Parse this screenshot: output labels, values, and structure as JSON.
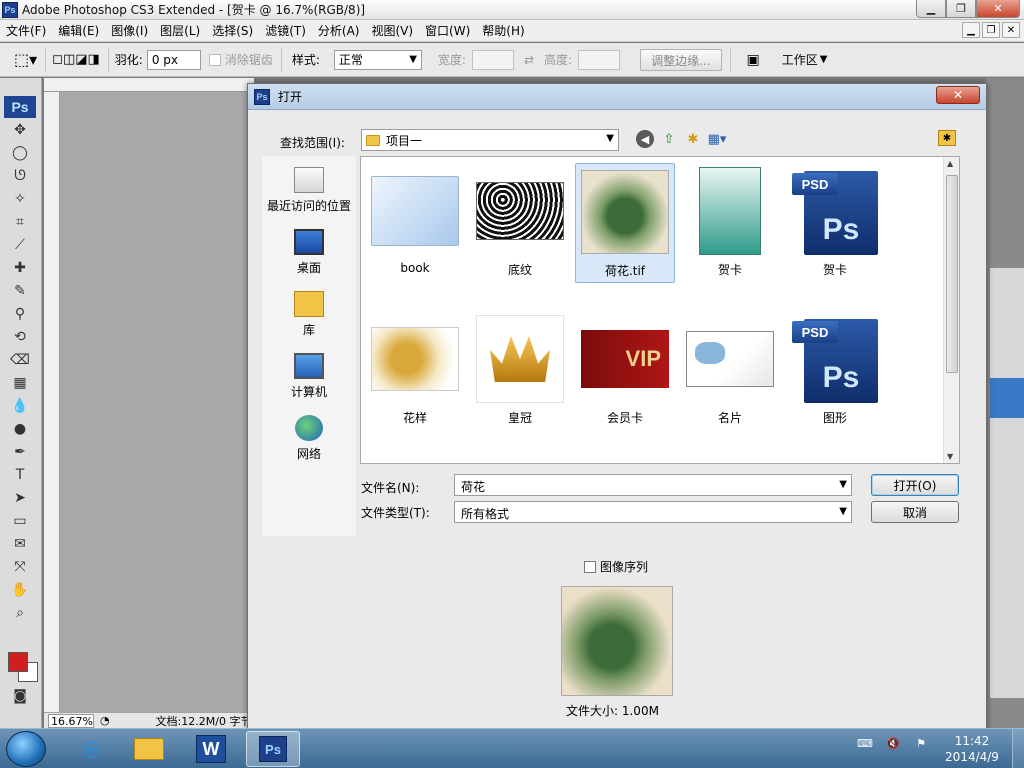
{
  "app": {
    "title": "Adobe Photoshop CS3 Extended - [贺卡 @ 16.7%(RGB/8)]",
    "icon_label": "Ps"
  },
  "menu": [
    "文件(F)",
    "编辑(E)",
    "图像(I)",
    "图层(L)",
    "选择(S)",
    "滤镜(T)",
    "分析(A)",
    "视图(V)",
    "窗口(W)",
    "帮助(H)"
  ],
  "options_bar": {
    "feather_label": "羽化:",
    "feather_value": "0 px",
    "antialias_label": "消除锯齿",
    "style_label": "样式:",
    "style_value": "正常",
    "width_label": "宽度:",
    "height_label": "高度:",
    "refine_button": "调整边缘...",
    "workspace_label": "工作区"
  },
  "toolbox": {
    "ps_label": "Ps",
    "fg_color": "#d01f1f",
    "bg_color": "#ffffff"
  },
  "status": {
    "zoom": "16.67%",
    "doc_info": "文档:12.2M/0 字节"
  },
  "dialog": {
    "title": "打开",
    "look_in_label": "查找范围(I):",
    "look_in_value": "项目一",
    "places": [
      {
        "label": "最近访问的位置",
        "icon": "recent-places-icon"
      },
      {
        "label": "桌面",
        "icon": "desktop-icon"
      },
      {
        "label": "库",
        "icon": "library-icon"
      },
      {
        "label": "计算机",
        "icon": "computer-icon"
      },
      {
        "label": "网络",
        "icon": "network-icon"
      }
    ],
    "files": [
      {
        "label": "book"
      },
      {
        "label": "底纹"
      },
      {
        "label": "荷花.tif",
        "selected": true
      },
      {
        "label": "贺卡"
      },
      {
        "label": "贺卡"
      },
      {
        "label": "花样"
      },
      {
        "label": "皇冠"
      },
      {
        "label": "会员卡"
      },
      {
        "label": "名片"
      },
      {
        "label": "图形"
      }
    ],
    "psd_tag": "PSD",
    "psd_letters": "Ps",
    "vip_text": "VIP",
    "filename_label": "文件名(N):",
    "filename_value": "荷花",
    "filetype_label": "文件类型(T):",
    "filetype_value": "所有格式",
    "open_button": "打开(O)",
    "cancel_button": "取消",
    "sequence_label": "图像序列",
    "file_size": "文件大小: 1.00M"
  },
  "taskbar": {
    "time": "11:42",
    "date": "2014/4/9",
    "ps_label": "Ps",
    "word_label": "W"
  }
}
